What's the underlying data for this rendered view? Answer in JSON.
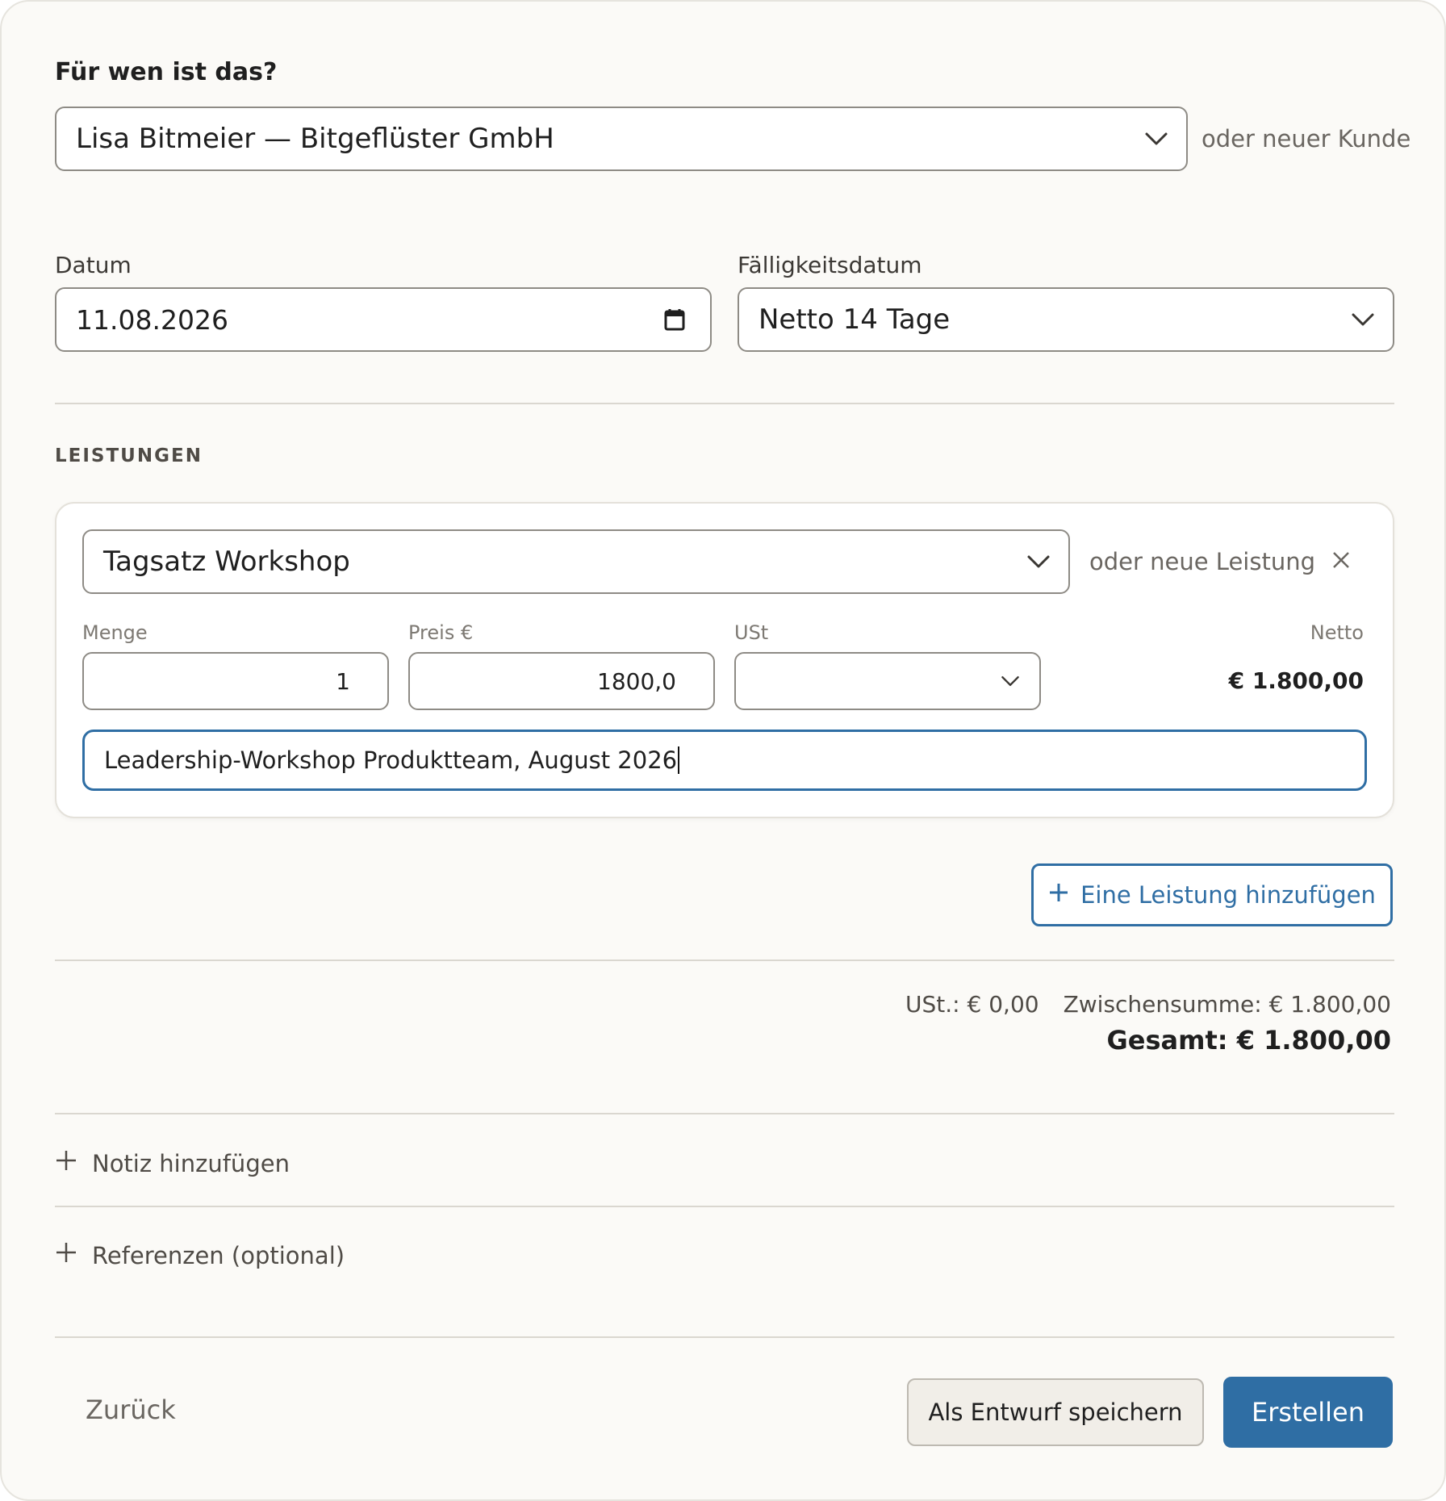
{
  "customer_section": {
    "title": "Für wen ist das?",
    "selected_customer": "Lisa Bitmeier — Bitgeflüster GmbH",
    "new_customer_link": "oder neuer Kunde"
  },
  "dates": {
    "date_label": "Datum",
    "date_value": "11.08.2026",
    "due_label": "Fälligkeitsdatum",
    "due_value": "Netto 14 Tage"
  },
  "services": {
    "heading": "LEISTUNGEN",
    "items": [
      {
        "service": "Tagsatz Workshop",
        "new_service_link": "oder neue Leistung",
        "quantity_label": "Menge",
        "quantity": "1",
        "price_label": "Preis €",
        "price": "1800,0",
        "vat_label": "USt",
        "vat": "",
        "net_label": "Netto",
        "net": "€ 1.800,00",
        "description": "Leadership-Workshop Produktteam, August 2026"
      }
    ],
    "add_button": "Eine Leistung hinzufügen"
  },
  "totals": {
    "vat": "USt.: € 0,00",
    "subtotal": "Zwischensumme: € 1.800,00",
    "total": "Gesamt: € 1.800,00"
  },
  "expanders": {
    "note": "Notiz hinzufügen",
    "references": "Referenzen (optional)"
  },
  "footer": {
    "back": "Zurück",
    "save_draft": "Als Entwurf speichern",
    "create": "Erstellen"
  },
  "colors": {
    "accent": "#2f6ea4",
    "background": "#fbfaf7",
    "border": "#8e8b85"
  }
}
